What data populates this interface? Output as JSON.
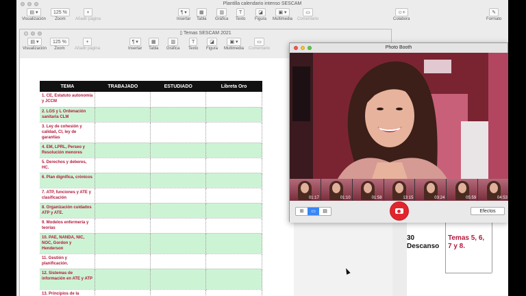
{
  "back_window": {
    "title": "Plantilla calendario intenso SESCAM",
    "toolbar": [
      {
        "icon": "sidebar-icon",
        "label": "Visualización",
        "dim": false
      },
      {
        "btn": "125 %",
        "label": "Zoom",
        "dim": false
      },
      {
        "icon": "plus-icon",
        "label": "Añadir página",
        "dim": true
      },
      {
        "icon": "paragraph-icon",
        "label": "Insertar",
        "dim": false
      },
      {
        "icon": "table-icon",
        "label": "Tabla",
        "dim": false
      },
      {
        "icon": "chart-icon",
        "label": "Gráfica",
        "dim": false
      },
      {
        "icon": "text-icon",
        "label": "Texto",
        "dim": false
      },
      {
        "icon": "shape-icon",
        "label": "Figura",
        "dim": false
      },
      {
        "icon": "media-icon",
        "label": "Multimedia",
        "dim": false
      },
      {
        "icon": "comment-icon",
        "label": "Comentario",
        "dim": true
      },
      {
        "icon": "collaborate-icon",
        "label": "Colabora",
        "dim": false
      },
      {
        "icon": "format-icon",
        "label": "Formato",
        "dim": false
      }
    ],
    "doc": {
      "cell_left": "30\nDescanso",
      "cell_right": "Temas 5, 6,\n7 y 8."
    }
  },
  "front_window": {
    "title": "Temas SESCAM 2021",
    "toolbar": [
      {
        "label": "Visualización",
        "dim": false
      },
      {
        "btn": "125 %",
        "label": "Zoom",
        "dim": false
      },
      {
        "label": "Añadir página",
        "dim": true
      },
      {
        "label": "Insertar",
        "dim": false
      },
      {
        "label": "Tabla",
        "dim": false
      },
      {
        "label": "Gráfica",
        "dim": false
      },
      {
        "label": "Texto",
        "dim": false
      },
      {
        "label": "Figura",
        "dim": false
      },
      {
        "label": "Multimedia",
        "dim": false
      },
      {
        "label": "Comentario",
        "dim": true
      }
    ],
    "table": {
      "headers": [
        "TEMA",
        "TRABAJADO",
        "ESTUDIADO",
        "Libreta Oro"
      ],
      "rows": [
        "1. CE, Estatuto autonomía y JCCM",
        "2. LGS y L Ordenación sanitaria CLM",
        "3. Ley de cohesión y calidad, CI, ley de garantías",
        "4. EM, LPRL, Perseo y Resolución menores",
        "5. Derechos y deberes, HC.",
        "6. Plan dignifica, crónicos",
        "7. ATP, funciones y ATE y clasificación",
        "8. Organización cuidados ATP y ATE.",
        "9. Modelos enfermería y teorías",
        "10. PAE, NANDA, NIC, NOC, Gordon y Henderson",
        "11. Gestión y planificación.",
        "12. Sistemas de información en ATE y ATP",
        "13. Principios de la"
      ]
    }
  },
  "photo_booth": {
    "title": "Photo Booth",
    "thumbnails": [
      "01:17",
      "01:10",
      "01:58",
      "13:15",
      "03:24",
      "05:59",
      "04:53"
    ],
    "effects_label": "Efectos",
    "view_modes": [
      "grid-icon",
      "single-icon",
      "filmstrip-icon"
    ]
  }
}
